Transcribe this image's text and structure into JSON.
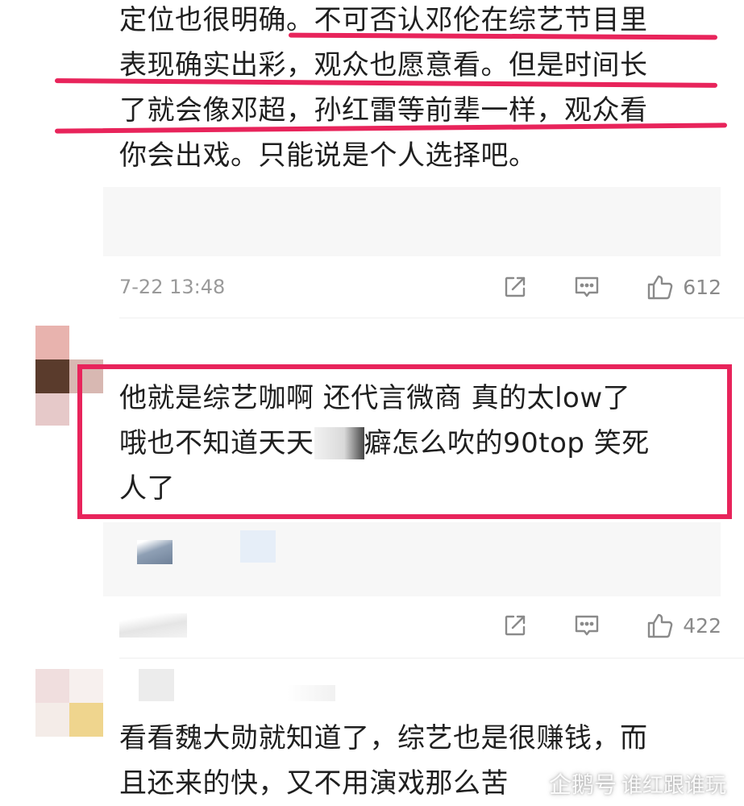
{
  "comment1": {
    "lines": [
      "定位也很明确。不可否认邓伦在综艺节目里",
      "表现确实出彩，观众也愿意看。但是时间长",
      "了就会像邓超，孙红雷等前辈一样，观众看",
      "你会出戏。只能说是个人选择吧。"
    ],
    "timestamp": "7-22 13:48",
    "like_count": "612"
  },
  "comment2": {
    "lines": [
      "他就是综艺咖啊 还代言微商 真的太low了",
      "哦也不知道天天",
      "癖怎么吹的90top 笑死",
      "人了"
    ],
    "like_count": "422"
  },
  "comment3": {
    "lines": [
      "看看魏大勋就知道了，综艺也是很赚钱，而",
      "且还来的快，又不用演戏那么苦"
    ]
  },
  "watermark": {
    "logo": "企鹅号",
    "text": "谁红跟谁玩"
  },
  "icons": [
    "share-icon",
    "comment-icon",
    "thumbs-up-icon"
  ],
  "colors": {
    "highlight": "#e8245b",
    "meta_text": "#9a9a9a",
    "reply_bg": "#f7f7f7"
  }
}
